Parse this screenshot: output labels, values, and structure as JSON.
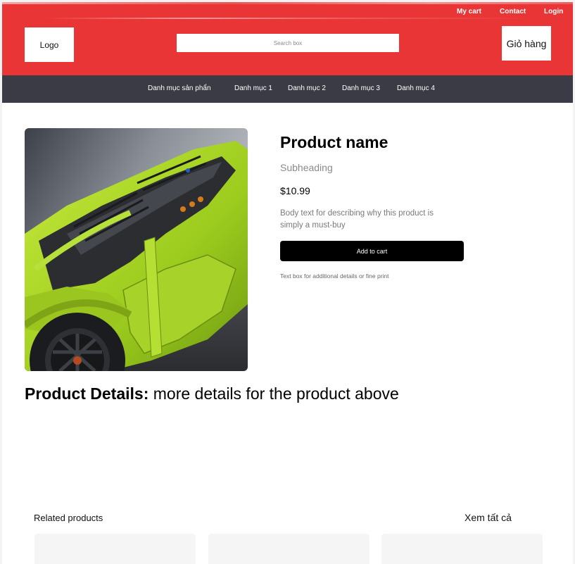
{
  "header": {
    "links": {
      "cart": "My cart",
      "contact": "Contact",
      "login": "Login"
    },
    "logo_label": "Logo",
    "search_placeholder": "Search box",
    "cart_label": "Giỏ hàng",
    "background": "#e93535"
  },
  "nav": {
    "items": [
      "Danh mục sản phẩn",
      "Danh mục 1",
      "Danh mục 2",
      "Danh mục 3",
      "Danh mục 4"
    ],
    "background": "#3b3b45"
  },
  "product": {
    "name": "Product name",
    "subheading": "Subheading",
    "price": "$10.99",
    "body": "Body text for describing why this product is simply a must-buy",
    "add_to_cart": "Add to cart",
    "fine_print": "Text box for additional details or fine print",
    "image_subject": "lime-green-lego-sports-car"
  },
  "details": {
    "label": "Product Details:",
    "text": "more details for the product above"
  },
  "related": {
    "title": "Related products",
    "see_all": "Xem tất cả",
    "card_count": 3
  }
}
